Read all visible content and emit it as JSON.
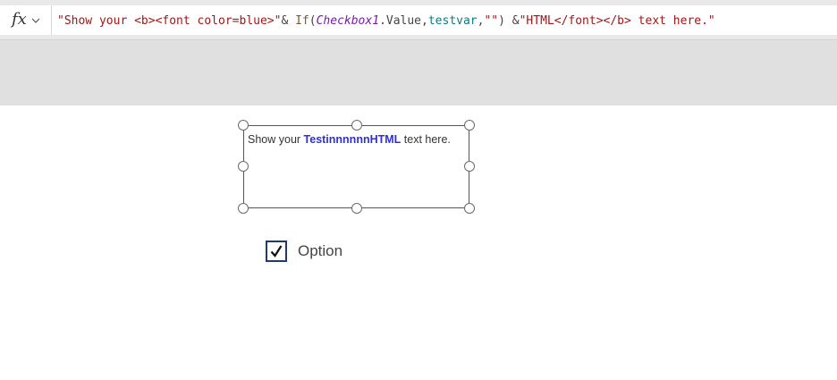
{
  "formula_bar": {
    "fx_label": "fx",
    "fx_icon": "fx-icon",
    "chevron_icon": "chevron-down-icon",
    "tokens": [
      {
        "text": "\"Show your <b><font color=blue>\"",
        "kind": "str"
      },
      {
        "text": "& ",
        "kind": "op"
      },
      {
        "text": "If",
        "kind": "fn"
      },
      {
        "text": "(",
        "kind": "op"
      },
      {
        "text": "Checkbox1",
        "kind": "ctrl"
      },
      {
        "text": ".Value,",
        "kind": "op"
      },
      {
        "text": "testvar",
        "kind": "var"
      },
      {
        "text": ",",
        "kind": "op"
      },
      {
        "text": "\"\"",
        "kind": "str"
      },
      {
        "text": ") &",
        "kind": "op"
      },
      {
        "text": "\"HTML</font></b> text here.\"",
        "kind": "str"
      }
    ]
  },
  "html_text": {
    "prefix": "Show your ",
    "bold_text": "TestinnnnnnHTML",
    "suffix": " text here.",
    "bold_color": "#2f2fe0"
  },
  "checkbox": {
    "label": "Option",
    "checked": true,
    "check_icon": "checkmark-icon"
  },
  "colors": {
    "string": "#a31515",
    "function": "#795e26",
    "control": "#7a1ca8",
    "variable": "#0f7b80",
    "checkbox_border": "#1f3a6e"
  }
}
